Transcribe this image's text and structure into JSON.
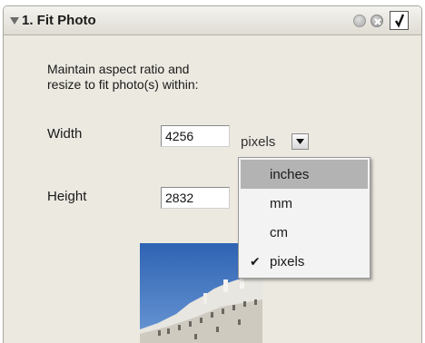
{
  "panel": {
    "title": "1. Fit Photo",
    "description_line1": "Maintain aspect ratio and",
    "description_line2": "resize to fit photo(s) within:"
  },
  "fields": {
    "width_label": "Width",
    "width_value": "4256",
    "height_label": "Height",
    "height_value": "2832"
  },
  "unit": {
    "selected": "pixels",
    "options": [
      "inches",
      "mm",
      "cm",
      "pixels"
    ],
    "hovered": "inches",
    "checked": "pixels",
    "check_glyph": "✔"
  },
  "icons": {
    "collapse": "triangle-down-icon",
    "help": "help-icon",
    "close": "close-icon",
    "enabled_check": "checkmark-icon",
    "dropdown": "chevron-down-icon"
  },
  "colors": {
    "panel_bg": "#ece9e1",
    "menu_hover": "#b3b3b3",
    "sky": "#3d74c0"
  }
}
